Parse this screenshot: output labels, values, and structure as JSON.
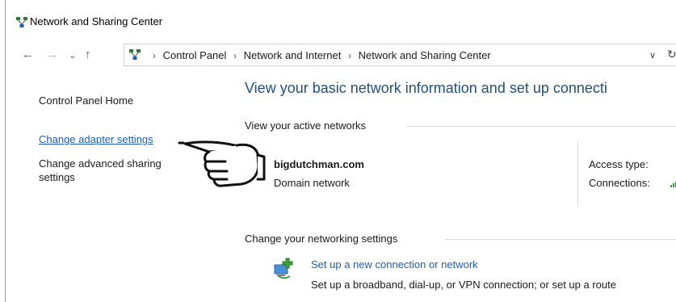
{
  "window": {
    "title": "Network and Sharing Center",
    "title_icon": "network-center-icon"
  },
  "address_bar": {
    "back_icon": "back-arrow-icon",
    "forward_icon": "forward-arrow-icon",
    "recent_icon": "recent-locations-chevron-icon",
    "up_icon": "up-arrow-icon",
    "crumbs": [
      "Control Panel",
      "Network and Internet",
      "Network and Sharing Center"
    ],
    "dropdown_icon": "address-dropdown-icon",
    "refresh_icon": "refresh-icon"
  },
  "left_pane": {
    "home": "Control Panel Home",
    "link_adapter": "Change adapter settings",
    "link_advanced_line1": "Change advanced sharing",
    "link_advanced_line2": "settings"
  },
  "main": {
    "title": "View your basic network information and set up connecti",
    "active_networks_heading": "View your active networks",
    "network": {
      "name": "bigdutchman.com",
      "type": "Domain network",
      "access_type_label": "Access type:",
      "connections_label": "Connections:"
    },
    "change_settings_heading": "Change your networking settings",
    "task": {
      "link": "Set up a new connection or network",
      "description": "Set up a broadband, dial-up, or VPN connection; or set up a route"
    }
  },
  "colors": {
    "link": "#1a5dbd",
    "title": "#1e4e8c",
    "signal": "#3a9a3a"
  }
}
